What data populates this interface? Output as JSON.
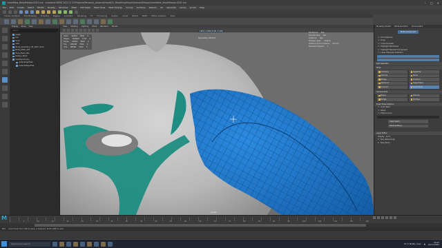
{
  "window": {
    "title": "cheekNew_BodyRetopo.0001.ma - Autodesk MAYA 2022.3: D:\\Projects\\Personal_projects\\Head\\21_Modelling\\Maya\\Scenes\\Retopo\\cheekNew_BodyRetopo.0001.ma"
  },
  "menubar": [
    "File",
    "Edit",
    "Create",
    "Select",
    "Modify",
    "Display",
    "Windows",
    "Mesh",
    "Edit Mesh",
    "Mesh Tools",
    "Mesh Display",
    "Curves",
    "Surfaces",
    "Deform",
    "UV",
    "Generate",
    "Cache",
    "Arnold",
    "Help"
  ],
  "shelf_tabs": [
    "Curves / Surfaces",
    "Poly Modeling",
    "Sculpting",
    "Rigging",
    "Animation",
    "Rendering",
    "FX",
    "FX Caching",
    "Custom",
    "Arnold",
    "Bifrost",
    "MASH",
    "Motion Graphics",
    "XGen"
  ],
  "outliner": {
    "menu": [
      "Display",
      "Show",
      "Help"
    ],
    "search_placeholder": "Search...",
    "items": [
      {
        "label": "persp",
        "indent": false
      },
      {
        "label": "top",
        "indent": false
      },
      {
        "label": "front",
        "indent": false
      },
      {
        "label": "side",
        "indent": false
      },
      {
        "label": "Body_Geometry_UP_2022 (null)",
        "indent": false
      },
      {
        "label": "Body_Mesh_002",
        "indent": false
      },
      {
        "label": "Face_Mesh_001",
        "indent": false
      },
      {
        "label": "Retopo_Mesh",
        "indent": false
      },
      {
        "label": "headSymmetry",
        "indent": false
      },
      {
        "label": "defaultLightSet",
        "indent": true
      },
      {
        "label": "defaultObjectSet",
        "indent": true
      }
    ]
  },
  "viewport": {
    "menu": [
      "View",
      "Shading",
      "Lighting",
      "Show",
      "Renderer",
      "Panels"
    ],
    "hud_left": [
      [
        "Verts:",
        "98560",
        "3892",
        "0"
      ],
      [
        "Edges:",
        "196840",
        "7718",
        "0"
      ],
      [
        "Faces:",
        "98304",
        "3826",
        "0"
      ],
      [
        "Tris:",
        "196608",
        "7652",
        "0"
      ],
      [
        "UVs:",
        "98560",
        "4012",
        "0"
      ]
    ],
    "hud_mid": "1920 x 1080 (0.00 x 0.00)",
    "hud_right": [
      [
        "Backfaces:",
        "N/A"
      ],
      [
        "Smoothness:",
        "N/A"
      ],
      [
        "Instance:",
        "N/A"
      ],
      [
        "Display Layer:",
        "default"
      ],
      [
        "Distance From Camera:",
        "48.371"
      ],
      [
        "Selected Objects:",
        "1"
      ]
    ],
    "symmetry": "Symmetry: World X",
    "camera_label": "persp"
  },
  "right_panel": {
    "tabs": [
      "Modeling Toolkit",
      "Attribute Editor",
      "Channel Box"
    ],
    "tool_name": "Multi-Component",
    "pick_rows": [
      "Pick Distance",
      "Drag",
      "Camera based"
    ],
    "highlight_rows": [
      "Highlight Backfaces",
      "Highlight Nearest Component",
      "Lasso Marquee Selection"
    ],
    "softsel_label": "Soft Selection",
    "tools_label": "Tools",
    "tool_buttons": [
      "Combine",
      "Separate",
      "Extrude",
      "Bevel",
      "Bridge",
      "Conform",
      "Multi-Cut",
      "Target Weld",
      "Connect",
      "Quad Draw"
    ],
    "components_label": "Components",
    "comp_buttons": [
      "Bevel",
      "Extrude",
      "Bridge",
      "Fill Hole"
    ],
    "quad_draw_label": "Quad Draw Options",
    "quad_draw_rows": [
      "Auto Weld",
      "Relax",
      "Extend Loop"
    ],
    "buttons": [
      "Clear Seam",
      "Reset Settings"
    ],
    "layer_editor_label": "Layer Editor",
    "layer_menus": [
      "Display",
      "Anim"
    ],
    "layers": [
      "Geo_Retopology",
      "Face_Body"
    ]
  },
  "timeline": {
    "numbers": [
      "1",
      "5",
      "10",
      "15",
      "20",
      "25",
      "30",
      "35",
      "40",
      "45",
      "50",
      "55",
      "60",
      "65",
      "70",
      "75",
      "80",
      "85",
      "90",
      "95",
      "100",
      "105",
      "110",
      "115",
      "120"
    ]
  },
  "command_line": {
    "label": "MEL",
    "text": "Quad Draw Tool: LMB to place a dot/point, Shift+LMB to relax."
  },
  "taskbar": {
    "search_placeholder": "Type here to search",
    "weather": "21°C  Mostly clear",
    "time": "16:23",
    "date": "24/11/2022"
  },
  "colors": {
    "accent": "#1a9ba8",
    "retopo_blue": "#1e6fbf",
    "teal_mesh": "#1f8d82",
    "mesh_gray": "#bcbcbc",
    "viewport_bg": "#6d6d6d",
    "selection_blue": "#5b82ae"
  }
}
